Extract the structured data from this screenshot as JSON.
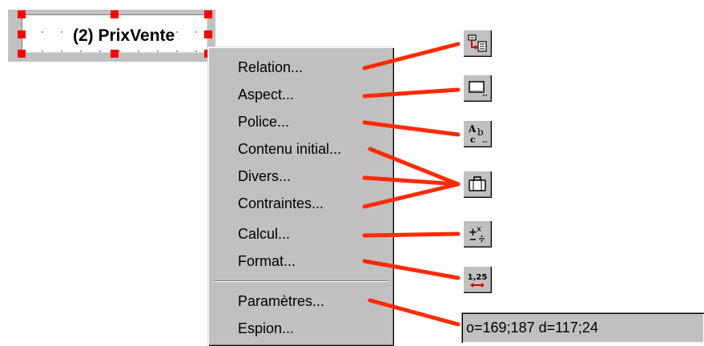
{
  "field": {
    "label": "(2) PrixVente"
  },
  "menu": {
    "items": [
      {
        "label": "Relation..."
      },
      {
        "label": "Aspect..."
      },
      {
        "label": "Police..."
      },
      {
        "label": "Contenu initial..."
      },
      {
        "label": "Divers..."
      },
      {
        "label": "Contraintes..."
      },
      {
        "label": "Calcul..."
      },
      {
        "label": "Format..."
      },
      {
        "label": "Paramètres..."
      },
      {
        "label": "Espion..."
      }
    ]
  },
  "toolbar": {
    "buttons": [
      {
        "icon": "relation-icon"
      },
      {
        "icon": "aspect-icon"
      },
      {
        "icon": "font-icon"
      },
      {
        "icon": "briefcase-icon"
      },
      {
        "icon": "calculation-icon"
      },
      {
        "icon": "format-icon",
        "text": "1,25"
      }
    ]
  },
  "status": {
    "value": "o=169;187 d=117;24"
  },
  "colors": {
    "handle": "#ff0000",
    "connector": "#ff2a00",
    "menu_bg": "#c0c0c0"
  }
}
